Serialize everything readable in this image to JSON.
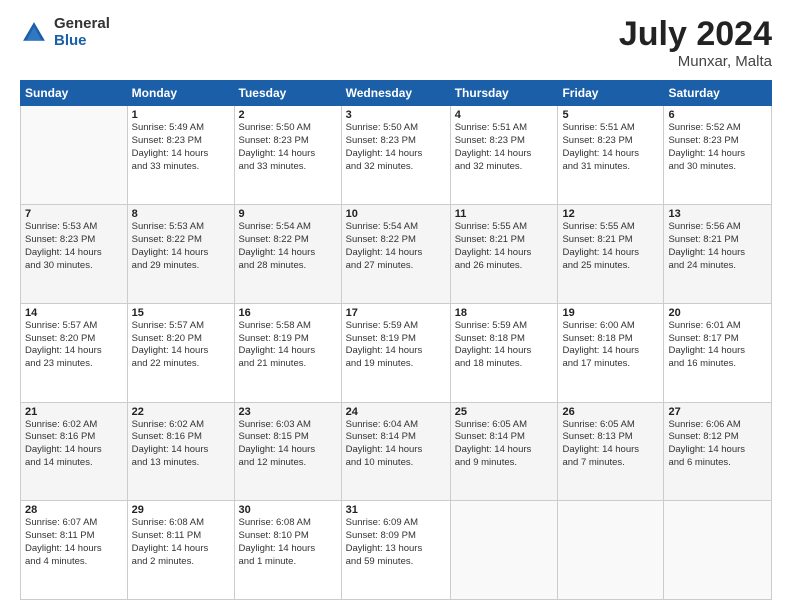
{
  "header": {
    "logo_general": "General",
    "logo_blue": "Blue",
    "month_year": "July 2024",
    "location": "Munxar, Malta"
  },
  "weekdays": [
    "Sunday",
    "Monday",
    "Tuesday",
    "Wednesday",
    "Thursday",
    "Friday",
    "Saturday"
  ],
  "weeks": [
    [
      {
        "day": "",
        "info": ""
      },
      {
        "day": "1",
        "info": "Sunrise: 5:49 AM\nSunset: 8:23 PM\nDaylight: 14 hours\nand 33 minutes."
      },
      {
        "day": "2",
        "info": "Sunrise: 5:50 AM\nSunset: 8:23 PM\nDaylight: 14 hours\nand 33 minutes."
      },
      {
        "day": "3",
        "info": "Sunrise: 5:50 AM\nSunset: 8:23 PM\nDaylight: 14 hours\nand 32 minutes."
      },
      {
        "day": "4",
        "info": "Sunrise: 5:51 AM\nSunset: 8:23 PM\nDaylight: 14 hours\nand 32 minutes."
      },
      {
        "day": "5",
        "info": "Sunrise: 5:51 AM\nSunset: 8:23 PM\nDaylight: 14 hours\nand 31 minutes."
      },
      {
        "day": "6",
        "info": "Sunrise: 5:52 AM\nSunset: 8:23 PM\nDaylight: 14 hours\nand 30 minutes."
      }
    ],
    [
      {
        "day": "7",
        "info": "Sunrise: 5:53 AM\nSunset: 8:23 PM\nDaylight: 14 hours\nand 30 minutes."
      },
      {
        "day": "8",
        "info": "Sunrise: 5:53 AM\nSunset: 8:22 PM\nDaylight: 14 hours\nand 29 minutes."
      },
      {
        "day": "9",
        "info": "Sunrise: 5:54 AM\nSunset: 8:22 PM\nDaylight: 14 hours\nand 28 minutes."
      },
      {
        "day": "10",
        "info": "Sunrise: 5:54 AM\nSunset: 8:22 PM\nDaylight: 14 hours\nand 27 minutes."
      },
      {
        "day": "11",
        "info": "Sunrise: 5:55 AM\nSunset: 8:21 PM\nDaylight: 14 hours\nand 26 minutes."
      },
      {
        "day": "12",
        "info": "Sunrise: 5:55 AM\nSunset: 8:21 PM\nDaylight: 14 hours\nand 25 minutes."
      },
      {
        "day": "13",
        "info": "Sunrise: 5:56 AM\nSunset: 8:21 PM\nDaylight: 14 hours\nand 24 minutes."
      }
    ],
    [
      {
        "day": "14",
        "info": "Sunrise: 5:57 AM\nSunset: 8:20 PM\nDaylight: 14 hours\nand 23 minutes."
      },
      {
        "day": "15",
        "info": "Sunrise: 5:57 AM\nSunset: 8:20 PM\nDaylight: 14 hours\nand 22 minutes."
      },
      {
        "day": "16",
        "info": "Sunrise: 5:58 AM\nSunset: 8:19 PM\nDaylight: 14 hours\nand 21 minutes."
      },
      {
        "day": "17",
        "info": "Sunrise: 5:59 AM\nSunset: 8:19 PM\nDaylight: 14 hours\nand 19 minutes."
      },
      {
        "day": "18",
        "info": "Sunrise: 5:59 AM\nSunset: 8:18 PM\nDaylight: 14 hours\nand 18 minutes."
      },
      {
        "day": "19",
        "info": "Sunrise: 6:00 AM\nSunset: 8:18 PM\nDaylight: 14 hours\nand 17 minutes."
      },
      {
        "day": "20",
        "info": "Sunrise: 6:01 AM\nSunset: 8:17 PM\nDaylight: 14 hours\nand 16 minutes."
      }
    ],
    [
      {
        "day": "21",
        "info": "Sunrise: 6:02 AM\nSunset: 8:16 PM\nDaylight: 14 hours\nand 14 minutes."
      },
      {
        "day": "22",
        "info": "Sunrise: 6:02 AM\nSunset: 8:16 PM\nDaylight: 14 hours\nand 13 minutes."
      },
      {
        "day": "23",
        "info": "Sunrise: 6:03 AM\nSunset: 8:15 PM\nDaylight: 14 hours\nand 12 minutes."
      },
      {
        "day": "24",
        "info": "Sunrise: 6:04 AM\nSunset: 8:14 PM\nDaylight: 14 hours\nand 10 minutes."
      },
      {
        "day": "25",
        "info": "Sunrise: 6:05 AM\nSunset: 8:14 PM\nDaylight: 14 hours\nand 9 minutes."
      },
      {
        "day": "26",
        "info": "Sunrise: 6:05 AM\nSunset: 8:13 PM\nDaylight: 14 hours\nand 7 minutes."
      },
      {
        "day": "27",
        "info": "Sunrise: 6:06 AM\nSunset: 8:12 PM\nDaylight: 14 hours\nand 6 minutes."
      }
    ],
    [
      {
        "day": "28",
        "info": "Sunrise: 6:07 AM\nSunset: 8:11 PM\nDaylight: 14 hours\nand 4 minutes."
      },
      {
        "day": "29",
        "info": "Sunrise: 6:08 AM\nSunset: 8:11 PM\nDaylight: 14 hours\nand 2 minutes."
      },
      {
        "day": "30",
        "info": "Sunrise: 6:08 AM\nSunset: 8:10 PM\nDaylight: 14 hours\nand 1 minute."
      },
      {
        "day": "31",
        "info": "Sunrise: 6:09 AM\nSunset: 8:09 PM\nDaylight: 13 hours\nand 59 minutes."
      },
      {
        "day": "",
        "info": ""
      },
      {
        "day": "",
        "info": ""
      },
      {
        "day": "",
        "info": ""
      }
    ]
  ]
}
